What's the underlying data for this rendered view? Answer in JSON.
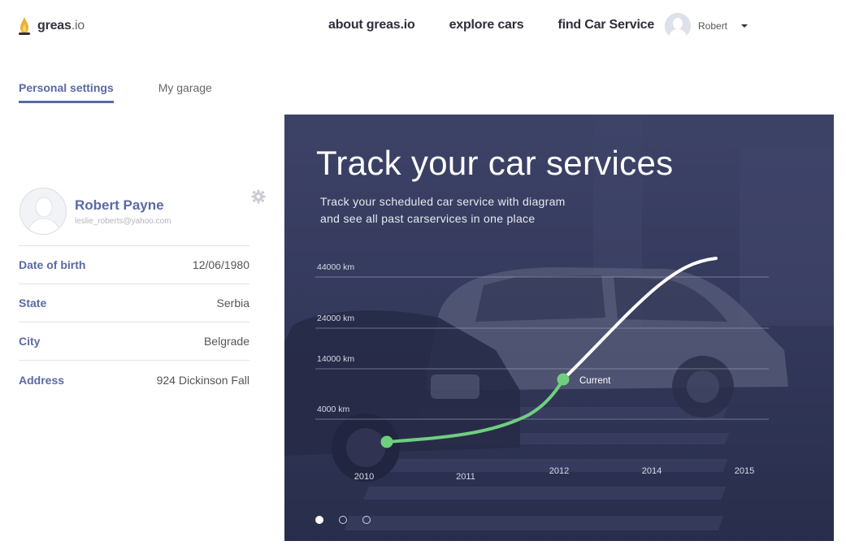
{
  "header": {
    "logo": {
      "name": "greas",
      "tld": ".io"
    },
    "nav": [
      {
        "label": "about greas.io"
      },
      {
        "label": "explore cars"
      },
      {
        "label": "find Car Service"
      }
    ],
    "user": {
      "name": "Robert"
    }
  },
  "tabs": [
    {
      "label": "Personal settings",
      "active": true
    },
    {
      "label": "My garage",
      "active": false
    }
  ],
  "profile": {
    "name": "Robert Payne",
    "email": "leslie_roberts@yahoo.com",
    "fields": [
      {
        "label": "Date of birth",
        "value": "12/06/1980"
      },
      {
        "label": "State",
        "value": "Serbia"
      },
      {
        "label": "City",
        "value": "Belgrade"
      },
      {
        "label": "Address",
        "value": "924 Dickinson Fall"
      }
    ]
  },
  "hero": {
    "title": "Track your car services",
    "subtitle": "Track your scheduled car service with diagram\nand see all past carservices in one place",
    "current_label": "Current",
    "slides": 3,
    "active_slide": 0
  },
  "colors": {
    "accent": "#5a6aa3",
    "past_line": "#6fcf7f",
    "future_line": "#ffffff",
    "hero_bg": "#2f3456"
  },
  "chart_data": {
    "type": "line",
    "y_levels": [
      {
        "label": "44000 km",
        "value": 44000
      },
      {
        "label": "24000 km",
        "value": 24000
      },
      {
        "label": "14000 km",
        "value": 14000
      },
      {
        "label": "4000 km",
        "value": 4000
      }
    ],
    "x_labels": [
      "2010",
      "2011",
      "2012",
      "2014",
      "2015"
    ],
    "series": [
      {
        "name": "past",
        "points": [
          [
            "2010",
            0
          ],
          [
            "2011",
            1500
          ],
          [
            "2012",
            12000
          ]
        ]
      },
      {
        "name": "future",
        "points": [
          [
            "2012",
            12000
          ],
          [
            "2014",
            34000
          ],
          [
            "2015",
            46000
          ]
        ]
      }
    ],
    "current_point": [
      "2012",
      12000
    ]
  }
}
